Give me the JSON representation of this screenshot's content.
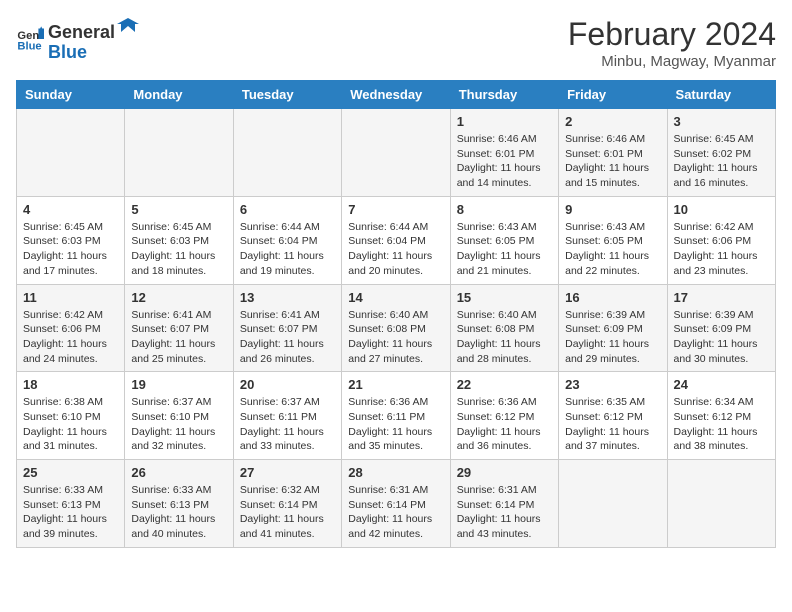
{
  "logo": {
    "text_general": "General",
    "text_blue": "Blue"
  },
  "title": "February 2024",
  "subtitle": "Minbu, Magway, Myanmar",
  "days_of_week": [
    "Sunday",
    "Monday",
    "Tuesday",
    "Wednesday",
    "Thursday",
    "Friday",
    "Saturday"
  ],
  "weeks": [
    [
      {
        "day": "",
        "info": ""
      },
      {
        "day": "",
        "info": ""
      },
      {
        "day": "",
        "info": ""
      },
      {
        "day": "",
        "info": ""
      },
      {
        "day": "1",
        "info": "Sunrise: 6:46 AM\nSunset: 6:01 PM\nDaylight: 11 hours and 14 minutes."
      },
      {
        "day": "2",
        "info": "Sunrise: 6:46 AM\nSunset: 6:01 PM\nDaylight: 11 hours and 15 minutes."
      },
      {
        "day": "3",
        "info": "Sunrise: 6:45 AM\nSunset: 6:02 PM\nDaylight: 11 hours and 16 minutes."
      }
    ],
    [
      {
        "day": "4",
        "info": "Sunrise: 6:45 AM\nSunset: 6:03 PM\nDaylight: 11 hours and 17 minutes."
      },
      {
        "day": "5",
        "info": "Sunrise: 6:45 AM\nSunset: 6:03 PM\nDaylight: 11 hours and 18 minutes."
      },
      {
        "day": "6",
        "info": "Sunrise: 6:44 AM\nSunset: 6:04 PM\nDaylight: 11 hours and 19 minutes."
      },
      {
        "day": "7",
        "info": "Sunrise: 6:44 AM\nSunset: 6:04 PM\nDaylight: 11 hours and 20 minutes."
      },
      {
        "day": "8",
        "info": "Sunrise: 6:43 AM\nSunset: 6:05 PM\nDaylight: 11 hours and 21 minutes."
      },
      {
        "day": "9",
        "info": "Sunrise: 6:43 AM\nSunset: 6:05 PM\nDaylight: 11 hours and 22 minutes."
      },
      {
        "day": "10",
        "info": "Sunrise: 6:42 AM\nSunset: 6:06 PM\nDaylight: 11 hours and 23 minutes."
      }
    ],
    [
      {
        "day": "11",
        "info": "Sunrise: 6:42 AM\nSunset: 6:06 PM\nDaylight: 11 hours and 24 minutes."
      },
      {
        "day": "12",
        "info": "Sunrise: 6:41 AM\nSunset: 6:07 PM\nDaylight: 11 hours and 25 minutes."
      },
      {
        "day": "13",
        "info": "Sunrise: 6:41 AM\nSunset: 6:07 PM\nDaylight: 11 hours and 26 minutes."
      },
      {
        "day": "14",
        "info": "Sunrise: 6:40 AM\nSunset: 6:08 PM\nDaylight: 11 hours and 27 minutes."
      },
      {
        "day": "15",
        "info": "Sunrise: 6:40 AM\nSunset: 6:08 PM\nDaylight: 11 hours and 28 minutes."
      },
      {
        "day": "16",
        "info": "Sunrise: 6:39 AM\nSunset: 6:09 PM\nDaylight: 11 hours and 29 minutes."
      },
      {
        "day": "17",
        "info": "Sunrise: 6:39 AM\nSunset: 6:09 PM\nDaylight: 11 hours and 30 minutes."
      }
    ],
    [
      {
        "day": "18",
        "info": "Sunrise: 6:38 AM\nSunset: 6:10 PM\nDaylight: 11 hours and 31 minutes."
      },
      {
        "day": "19",
        "info": "Sunrise: 6:37 AM\nSunset: 6:10 PM\nDaylight: 11 hours and 32 minutes."
      },
      {
        "day": "20",
        "info": "Sunrise: 6:37 AM\nSunset: 6:11 PM\nDaylight: 11 hours and 33 minutes."
      },
      {
        "day": "21",
        "info": "Sunrise: 6:36 AM\nSunset: 6:11 PM\nDaylight: 11 hours and 35 minutes."
      },
      {
        "day": "22",
        "info": "Sunrise: 6:36 AM\nSunset: 6:12 PM\nDaylight: 11 hours and 36 minutes."
      },
      {
        "day": "23",
        "info": "Sunrise: 6:35 AM\nSunset: 6:12 PM\nDaylight: 11 hours and 37 minutes."
      },
      {
        "day": "24",
        "info": "Sunrise: 6:34 AM\nSunset: 6:12 PM\nDaylight: 11 hours and 38 minutes."
      }
    ],
    [
      {
        "day": "25",
        "info": "Sunrise: 6:33 AM\nSunset: 6:13 PM\nDaylight: 11 hours and 39 minutes."
      },
      {
        "day": "26",
        "info": "Sunrise: 6:33 AM\nSunset: 6:13 PM\nDaylight: 11 hours and 40 minutes."
      },
      {
        "day": "27",
        "info": "Sunrise: 6:32 AM\nSunset: 6:14 PM\nDaylight: 11 hours and 41 minutes."
      },
      {
        "day": "28",
        "info": "Sunrise: 6:31 AM\nSunset: 6:14 PM\nDaylight: 11 hours and 42 minutes."
      },
      {
        "day": "29",
        "info": "Sunrise: 6:31 AM\nSunset: 6:14 PM\nDaylight: 11 hours and 43 minutes."
      },
      {
        "day": "",
        "info": ""
      },
      {
        "day": "",
        "info": ""
      }
    ]
  ]
}
